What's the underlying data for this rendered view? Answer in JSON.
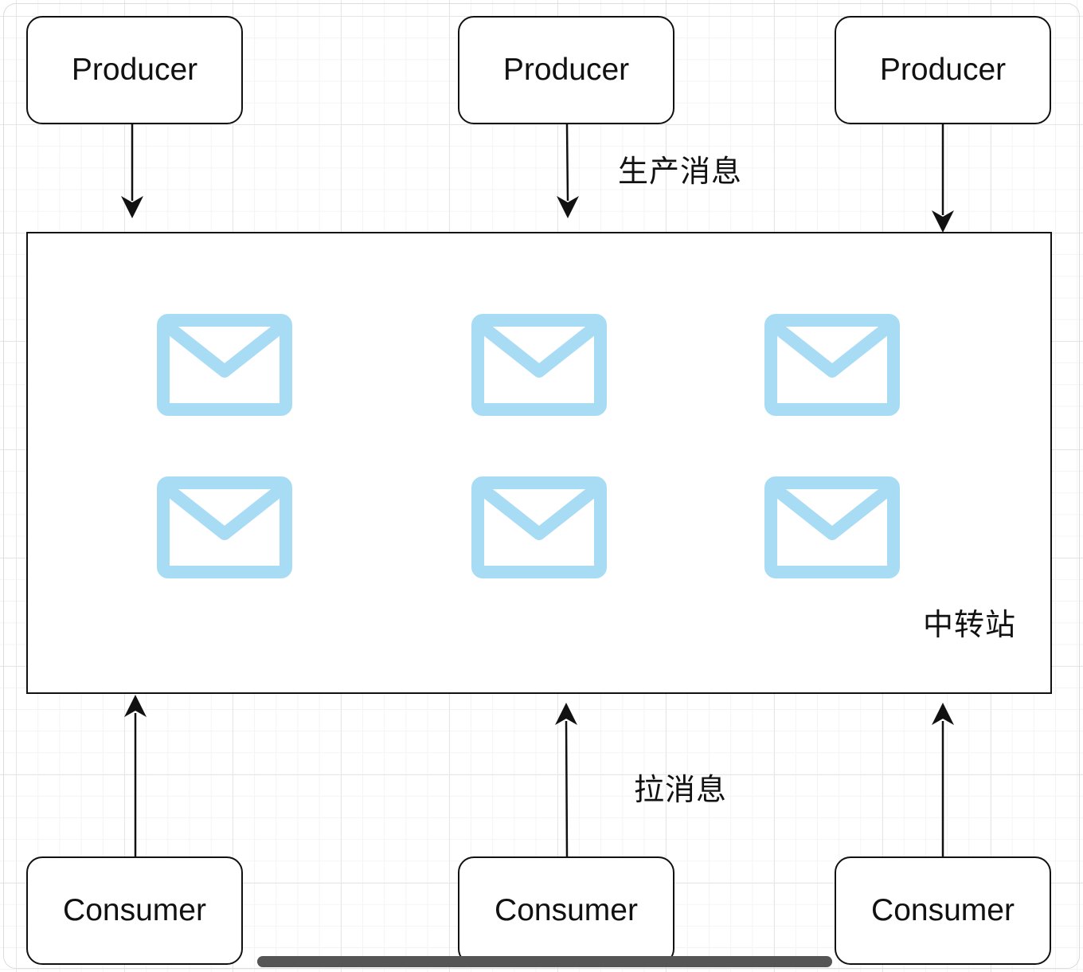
{
  "diagram": {
    "producers": [
      {
        "label": "Producer"
      },
      {
        "label": "Producer"
      },
      {
        "label": "Producer"
      }
    ],
    "consumers": [
      {
        "label": "Consumer"
      },
      {
        "label": "Consumer"
      },
      {
        "label": "Consumer"
      }
    ],
    "hub": {
      "label": "中转站",
      "message_count": 6,
      "message_icon": "envelope-icon",
      "message_color": "#a8dcf5"
    },
    "edge_labels": {
      "produce": "生产消息",
      "pull": "拉消息"
    },
    "colors": {
      "stroke": "#111111",
      "grid": "#e6e6e6"
    }
  }
}
